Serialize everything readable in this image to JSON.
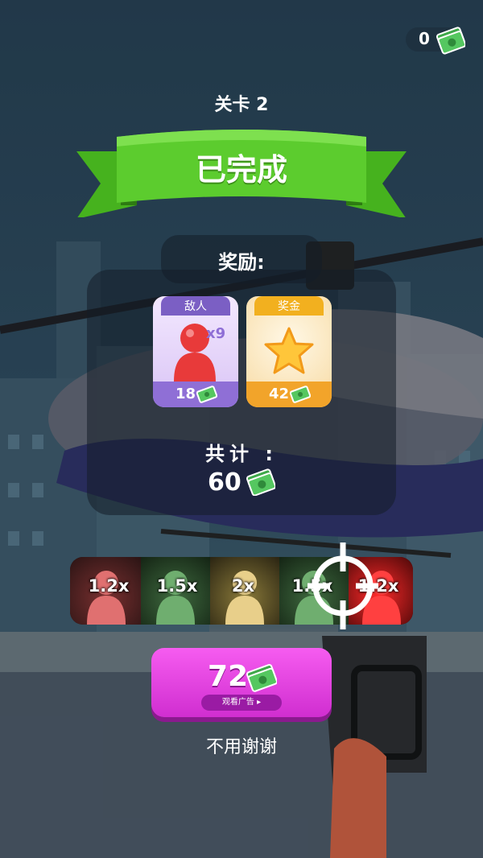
{
  "currency": {
    "count": "0",
    "icon": "cash-icon"
  },
  "level": {
    "text": "关卡 2"
  },
  "banner": {
    "text": "已完成"
  },
  "rewards": {
    "label": "奖励:",
    "enemies": {
      "tab": "敌人",
      "multiplier": "x9",
      "value": "18",
      "icon": "person-icon"
    },
    "bonus": {
      "tab": "奖金",
      "value": "42",
      "icon": "star-icon"
    }
  },
  "total": {
    "label": "共计 :",
    "value": "60"
  },
  "multiplier_bar": {
    "segments": [
      {
        "label": "1.2x",
        "color": "#c0403e"
      },
      {
        "label": "1.5x",
        "color": "#4a8a4a"
      },
      {
        "label": "2x",
        "color": "#d9b865"
      },
      {
        "label": "1.5x",
        "color": "#4a8a4a"
      },
      {
        "label": "1.2x",
        "color": "#e02020"
      }
    ]
  },
  "claim": {
    "value": "72",
    "ad_label": "观看广告 ▸"
  },
  "skip": {
    "label": "不用谢谢"
  },
  "colors": {
    "banner_green": "#5ccc2e",
    "claim_pink": "#e646e6",
    "enemy_purple": "#8f6fd6",
    "bonus_orange": "#f2a42a"
  }
}
